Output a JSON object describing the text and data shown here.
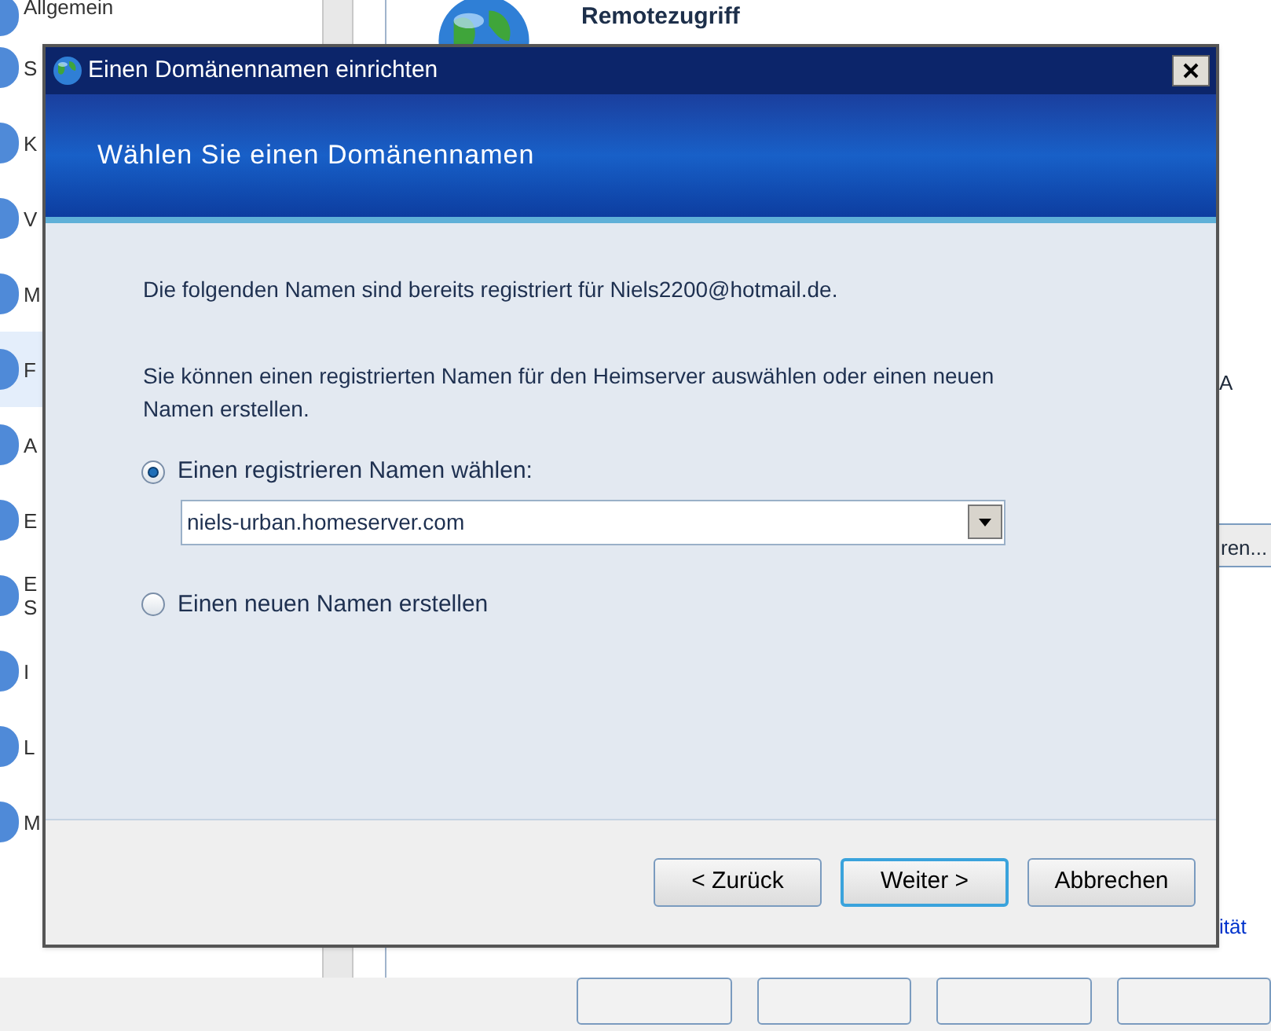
{
  "background_window": {
    "sidebar": {
      "items": [
        {
          "label": "Allgemein",
          "selected": false
        },
        {
          "label": "S",
          "selected": false
        },
        {
          "label": "K",
          "selected": false
        },
        {
          "label": "V",
          "selected": false
        },
        {
          "label": "M",
          "selected": false
        },
        {
          "label": "F",
          "selected": true
        },
        {
          "label": "A",
          "selected": false
        },
        {
          "label": "E",
          "selected": false
        },
        {
          "label": "E S",
          "selected": false
        },
        {
          "label": "I",
          "selected": false
        },
        {
          "label": "L",
          "selected": false
        },
        {
          "label": "M",
          "selected": false
        }
      ]
    },
    "panel": {
      "title": "Remotezugriff",
      "text_1": "A",
      "button_text": "ren...",
      "link": "ität"
    }
  },
  "dialog": {
    "title": "Einen Domänennamen einrichten",
    "heading": "Wählen Sie einen Domänennamen",
    "intro": "Die folgenden Namen sind bereits registriert für Niels2200@hotmail.de.",
    "description": "Sie können einen registrierten Namen für den Heimserver auswählen oder einen neuen Namen erstellen.",
    "options": [
      {
        "label": "Einen registrieren Namen wählen:",
        "selected": true,
        "dropdown": {
          "value": "niels-urban.homeserver.com"
        }
      },
      {
        "label": "Einen neuen Namen erstellen",
        "selected": false
      }
    ],
    "buttons": [
      {
        "label": "< Zurück",
        "default": false
      },
      {
        "label": "Weiter >",
        "default": true
      },
      {
        "label": "Abbrechen",
        "default": false
      }
    ]
  }
}
